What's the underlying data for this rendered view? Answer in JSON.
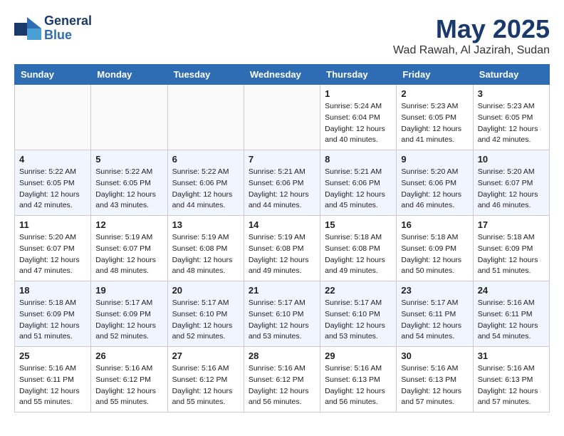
{
  "header": {
    "logo_general": "General",
    "logo_blue": "Blue",
    "month_title": "May 2025",
    "location": "Wad Rawah, Al Jazirah, Sudan"
  },
  "days_of_week": [
    "Sunday",
    "Monday",
    "Tuesday",
    "Wednesday",
    "Thursday",
    "Friday",
    "Saturday"
  ],
  "weeks": [
    [
      {
        "day": "",
        "info": ""
      },
      {
        "day": "",
        "info": ""
      },
      {
        "day": "",
        "info": ""
      },
      {
        "day": "",
        "info": ""
      },
      {
        "day": "1",
        "info": "Sunrise: 5:24 AM\nSunset: 6:04 PM\nDaylight: 12 hours\nand 40 minutes."
      },
      {
        "day": "2",
        "info": "Sunrise: 5:23 AM\nSunset: 6:05 PM\nDaylight: 12 hours\nand 41 minutes."
      },
      {
        "day": "3",
        "info": "Sunrise: 5:23 AM\nSunset: 6:05 PM\nDaylight: 12 hours\nand 42 minutes."
      }
    ],
    [
      {
        "day": "4",
        "info": "Sunrise: 5:22 AM\nSunset: 6:05 PM\nDaylight: 12 hours\nand 42 minutes."
      },
      {
        "day": "5",
        "info": "Sunrise: 5:22 AM\nSunset: 6:05 PM\nDaylight: 12 hours\nand 43 minutes."
      },
      {
        "day": "6",
        "info": "Sunrise: 5:22 AM\nSunset: 6:06 PM\nDaylight: 12 hours\nand 44 minutes."
      },
      {
        "day": "7",
        "info": "Sunrise: 5:21 AM\nSunset: 6:06 PM\nDaylight: 12 hours\nand 44 minutes."
      },
      {
        "day": "8",
        "info": "Sunrise: 5:21 AM\nSunset: 6:06 PM\nDaylight: 12 hours\nand 45 minutes."
      },
      {
        "day": "9",
        "info": "Sunrise: 5:20 AM\nSunset: 6:06 PM\nDaylight: 12 hours\nand 46 minutes."
      },
      {
        "day": "10",
        "info": "Sunrise: 5:20 AM\nSunset: 6:07 PM\nDaylight: 12 hours\nand 46 minutes."
      }
    ],
    [
      {
        "day": "11",
        "info": "Sunrise: 5:20 AM\nSunset: 6:07 PM\nDaylight: 12 hours\nand 47 minutes."
      },
      {
        "day": "12",
        "info": "Sunrise: 5:19 AM\nSunset: 6:07 PM\nDaylight: 12 hours\nand 48 minutes."
      },
      {
        "day": "13",
        "info": "Sunrise: 5:19 AM\nSunset: 6:08 PM\nDaylight: 12 hours\nand 48 minutes."
      },
      {
        "day": "14",
        "info": "Sunrise: 5:19 AM\nSunset: 6:08 PM\nDaylight: 12 hours\nand 49 minutes."
      },
      {
        "day": "15",
        "info": "Sunrise: 5:18 AM\nSunset: 6:08 PM\nDaylight: 12 hours\nand 49 minutes."
      },
      {
        "day": "16",
        "info": "Sunrise: 5:18 AM\nSunset: 6:09 PM\nDaylight: 12 hours\nand 50 minutes."
      },
      {
        "day": "17",
        "info": "Sunrise: 5:18 AM\nSunset: 6:09 PM\nDaylight: 12 hours\nand 51 minutes."
      }
    ],
    [
      {
        "day": "18",
        "info": "Sunrise: 5:18 AM\nSunset: 6:09 PM\nDaylight: 12 hours\nand 51 minutes."
      },
      {
        "day": "19",
        "info": "Sunrise: 5:17 AM\nSunset: 6:09 PM\nDaylight: 12 hours\nand 52 minutes."
      },
      {
        "day": "20",
        "info": "Sunrise: 5:17 AM\nSunset: 6:10 PM\nDaylight: 12 hours\nand 52 minutes."
      },
      {
        "day": "21",
        "info": "Sunrise: 5:17 AM\nSunset: 6:10 PM\nDaylight: 12 hours\nand 53 minutes."
      },
      {
        "day": "22",
        "info": "Sunrise: 5:17 AM\nSunset: 6:10 PM\nDaylight: 12 hours\nand 53 minutes."
      },
      {
        "day": "23",
        "info": "Sunrise: 5:17 AM\nSunset: 6:11 PM\nDaylight: 12 hours\nand 54 minutes."
      },
      {
        "day": "24",
        "info": "Sunrise: 5:16 AM\nSunset: 6:11 PM\nDaylight: 12 hours\nand 54 minutes."
      }
    ],
    [
      {
        "day": "25",
        "info": "Sunrise: 5:16 AM\nSunset: 6:11 PM\nDaylight: 12 hours\nand 55 minutes."
      },
      {
        "day": "26",
        "info": "Sunrise: 5:16 AM\nSunset: 6:12 PM\nDaylight: 12 hours\nand 55 minutes."
      },
      {
        "day": "27",
        "info": "Sunrise: 5:16 AM\nSunset: 6:12 PM\nDaylight: 12 hours\nand 55 minutes."
      },
      {
        "day": "28",
        "info": "Sunrise: 5:16 AM\nSunset: 6:12 PM\nDaylight: 12 hours\nand 56 minutes."
      },
      {
        "day": "29",
        "info": "Sunrise: 5:16 AM\nSunset: 6:13 PM\nDaylight: 12 hours\nand 56 minutes."
      },
      {
        "day": "30",
        "info": "Sunrise: 5:16 AM\nSunset: 6:13 PM\nDaylight: 12 hours\nand 57 minutes."
      },
      {
        "day": "31",
        "info": "Sunrise: 5:16 AM\nSunset: 6:13 PM\nDaylight: 12 hours\nand 57 minutes."
      }
    ]
  ]
}
